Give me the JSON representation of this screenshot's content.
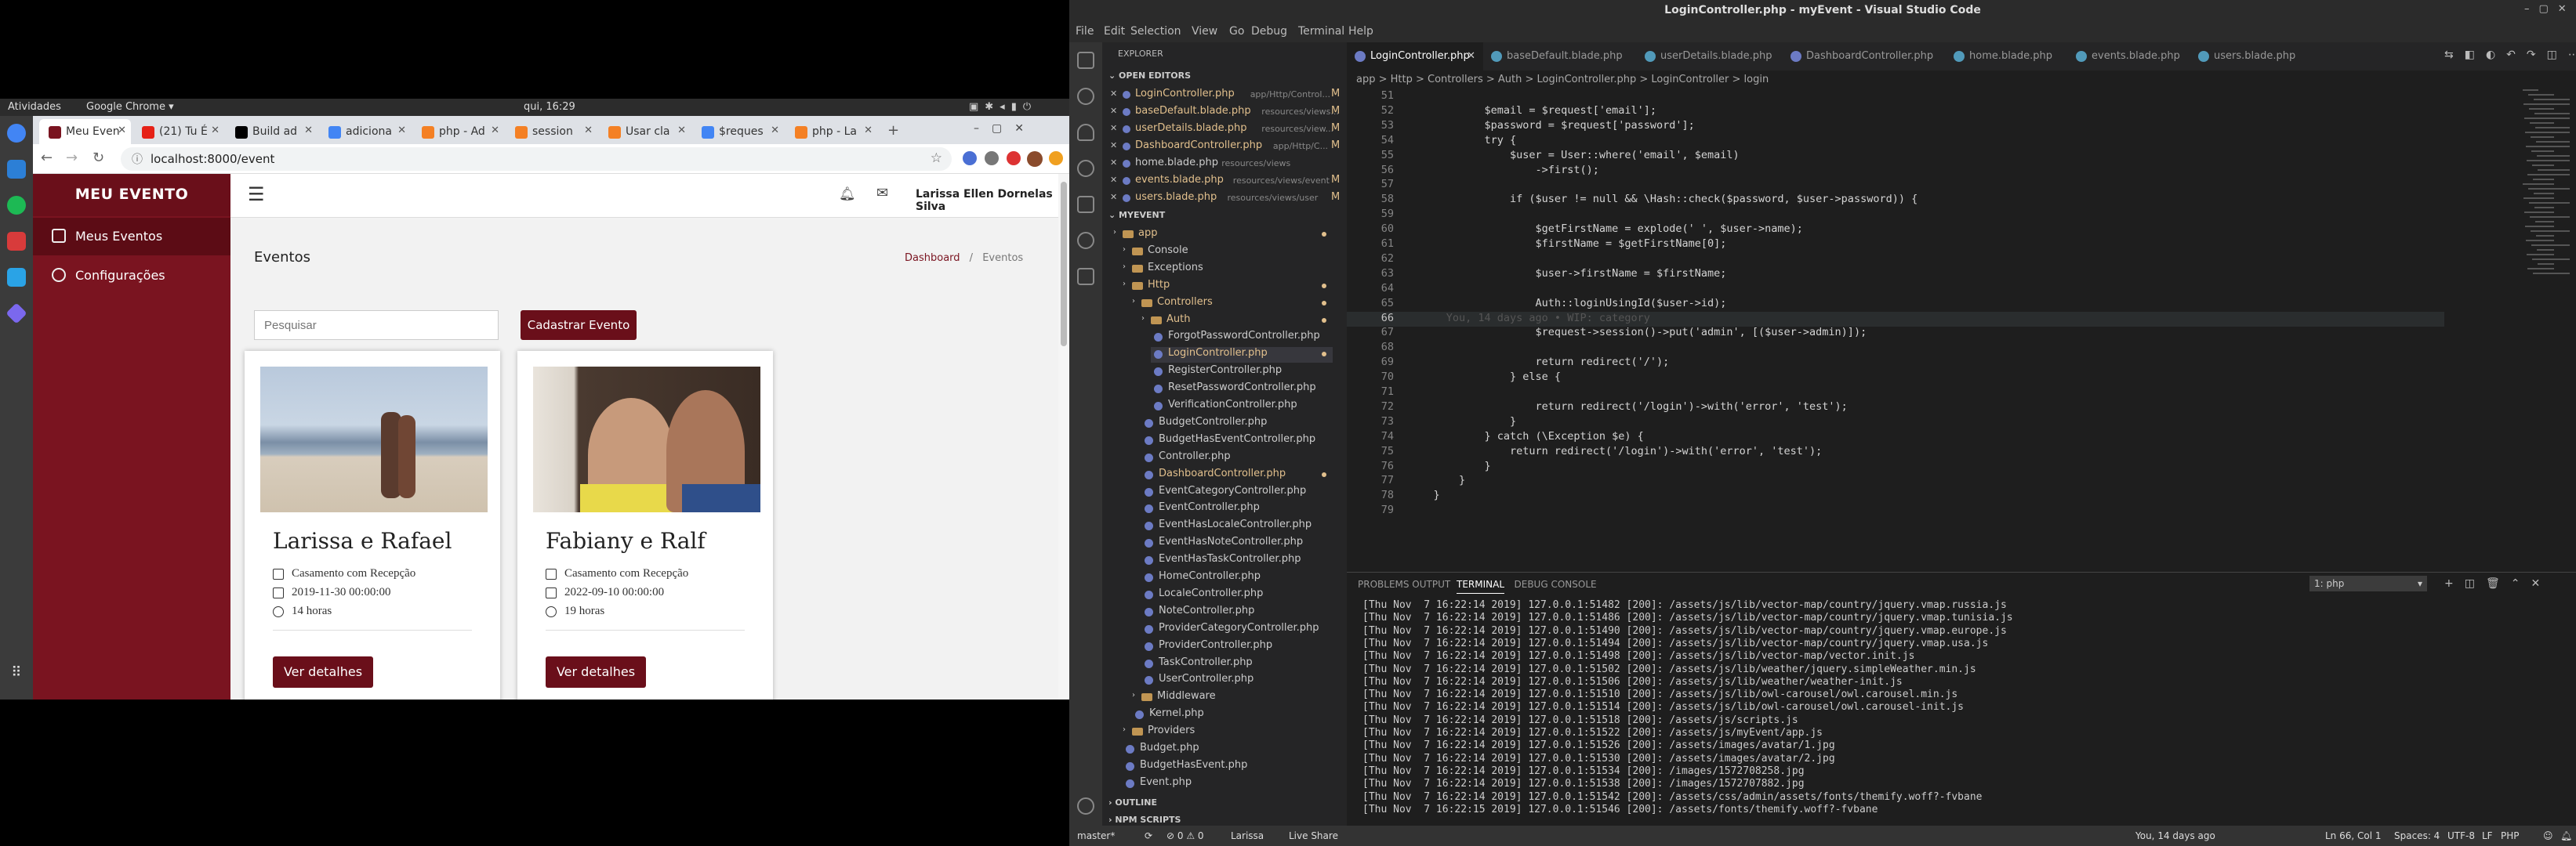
{
  "system": {
    "activities": "Atividades",
    "app_menu": "Google Chrome ▾",
    "clock": "qui, 16:29"
  },
  "chrome": {
    "tabs": [
      {
        "label": "Meu Even",
        "color": "#7a1420"
      },
      {
        "label": "(21) Tu É",
        "color": "#e62117"
      },
      {
        "label": "Build ad",
        "color": "#000000"
      },
      {
        "label": "adiciona",
        "color": "#4285f4"
      },
      {
        "label": "php - Ad",
        "color": "#f48024"
      },
      {
        "label": "session",
        "color": "#f48024"
      },
      {
        "label": "Usar cla",
        "color": "#f48024"
      },
      {
        "label": "$reques",
        "color": "#4285f4"
      },
      {
        "label": "php - La",
        "color": "#f48024"
      }
    ],
    "url": "localhost:8000/event"
  },
  "app": {
    "brand": "MEU EVENTO",
    "nav": [
      {
        "label": "Meus Eventos",
        "icon": "calendar-icon"
      },
      {
        "label": "Configurações",
        "icon": "gear-icon"
      }
    ],
    "user": "Larissa Ellen Dornelas Silva",
    "page_title": "Eventos",
    "breadcrumb": {
      "home": "Dashboard",
      "sep": "/",
      "current": "Eventos"
    },
    "search_placeholder": "Pesquisar",
    "create_button": "Cadastrar Evento",
    "events": [
      {
        "title": "Larissa e Rafael",
        "type": "Casamento  com  Recepção",
        "datetime": "2019-11-30  00:00:00",
        "duration": "14  horas",
        "button": "Ver detalhes"
      },
      {
        "title": "Fabiany e Ralf",
        "type": "Casamento  com  Recepção",
        "datetime": "2022-09-10  00:00:00",
        "duration": "19  horas",
        "button": "Ver detalhes"
      }
    ]
  },
  "vscode": {
    "title": "LoginController.php - myEvent - Visual Studio Code",
    "menu": [
      "File",
      "Edit",
      "Selection",
      "View",
      "Go",
      "Debug",
      "Terminal",
      "Help"
    ],
    "explorer_header": "EXPLORER",
    "open_editors_header": "OPEN EDITORS",
    "open_editors": [
      {
        "name": "LoginController.php",
        "path": "app/Http/Control...",
        "badge": "M",
        "color": "#e2c08d"
      },
      {
        "name": "baseDefault.blade.php",
        "path": "resources/views...",
        "badge": "M",
        "color": "#e2c08d"
      },
      {
        "name": "userDetails.blade.php",
        "path": "resources/view...",
        "badge": "M",
        "color": "#e2c08d"
      },
      {
        "name": "DashboardController.php",
        "path": "app/Http/C...",
        "badge": "M",
        "color": "#e2c08d"
      },
      {
        "name": "home.blade.php",
        "path": "resources/views",
        "badge": "",
        "color": "#cccccc"
      },
      {
        "name": "events.blade.php",
        "path": "resources/views/event",
        "badge": "M",
        "color": "#e2c08d"
      },
      {
        "name": "users.blade.php",
        "path": "resources/views/user",
        "badge": "M",
        "color": "#e2c08d"
      }
    ],
    "project_header": "MYEVENT",
    "tree": [
      {
        "name": "app",
        "indent": 0,
        "folder": true,
        "color": "#e2c08d"
      },
      {
        "name": "Console",
        "indent": 1,
        "folder": true,
        "color": "#cccccc"
      },
      {
        "name": "Exceptions",
        "indent": 1,
        "folder": true,
        "color": "#cccccc"
      },
      {
        "name": "Http",
        "indent": 1,
        "folder": true,
        "color": "#e2c08d"
      },
      {
        "name": "Controllers",
        "indent": 2,
        "folder": true,
        "color": "#e2c08d"
      },
      {
        "name": "Auth",
        "indent": 3,
        "folder": true,
        "color": "#e2c08d"
      },
      {
        "name": "ForgotPasswordController.php",
        "indent": 4,
        "folder": false,
        "color": "#cccccc"
      },
      {
        "name": "LoginController.php",
        "indent": 4,
        "folder": false,
        "color": "#e2c08d"
      },
      {
        "name": "RegisterController.php",
        "indent": 4,
        "folder": false,
        "color": "#cccccc"
      },
      {
        "name": "ResetPasswordController.php",
        "indent": 4,
        "folder": false,
        "color": "#cccccc"
      },
      {
        "name": "VerificationController.php",
        "indent": 4,
        "folder": false,
        "color": "#cccccc"
      },
      {
        "name": "BudgetController.php",
        "indent": 3,
        "folder": false,
        "color": "#cccccc"
      },
      {
        "name": "BudgetHasEventController.php",
        "indent": 3,
        "folder": false,
        "color": "#cccccc"
      },
      {
        "name": "Controller.php",
        "indent": 3,
        "folder": false,
        "color": "#cccccc"
      },
      {
        "name": "DashboardController.php",
        "indent": 3,
        "folder": false,
        "color": "#e2c08d"
      },
      {
        "name": "EventCategoryController.php",
        "indent": 3,
        "folder": false,
        "color": "#cccccc"
      },
      {
        "name": "EventController.php",
        "indent": 3,
        "folder": false,
        "color": "#cccccc"
      },
      {
        "name": "EventHasLocaleController.php",
        "indent": 3,
        "folder": false,
        "color": "#cccccc"
      },
      {
        "name": "EventHasNoteController.php",
        "indent": 3,
        "folder": false,
        "color": "#cccccc"
      },
      {
        "name": "EventHasTaskController.php",
        "indent": 3,
        "folder": false,
        "color": "#cccccc"
      },
      {
        "name": "HomeController.php",
        "indent": 3,
        "folder": false,
        "color": "#cccccc"
      },
      {
        "name": "LocaleController.php",
        "indent": 3,
        "folder": false,
        "color": "#cccccc"
      },
      {
        "name": "NoteController.php",
        "indent": 3,
        "folder": false,
        "color": "#cccccc"
      },
      {
        "name": "ProviderCategoryController.php",
        "indent": 3,
        "folder": false,
        "color": "#cccccc"
      },
      {
        "name": "ProviderController.php",
        "indent": 3,
        "folder": false,
        "color": "#cccccc"
      },
      {
        "name": "TaskController.php",
        "indent": 3,
        "folder": false,
        "color": "#cccccc"
      },
      {
        "name": "UserController.php",
        "indent": 3,
        "folder": false,
        "color": "#cccccc"
      },
      {
        "name": "Middleware",
        "indent": 2,
        "folder": true,
        "color": "#cccccc"
      },
      {
        "name": "Kernel.php",
        "indent": 2,
        "folder": false,
        "color": "#cccccc"
      },
      {
        "name": "Providers",
        "indent": 1,
        "folder": true,
        "color": "#cccccc"
      },
      {
        "name": "Budget.php",
        "indent": 1,
        "folder": false,
        "color": "#cccccc"
      },
      {
        "name": "BudgetHasEvent.php",
        "indent": 1,
        "folder": false,
        "color": "#cccccc"
      },
      {
        "name": "Event.php",
        "indent": 1,
        "folder": false,
        "color": "#cccccc"
      }
    ],
    "outline": "OUTLINE",
    "npm": "NPM SCRIPTS",
    "tabs": [
      "LoginController.php",
      "baseDefault.blade.php",
      "userDetails.blade.php",
      "DashboardController.php",
      "home.blade.php",
      "events.blade.php",
      "users.blade.php"
    ],
    "breadcrumb": "app  >  Http  >  Controllers  >  Auth  >  LoginController.php  >  LoginController  >  login",
    "code": [
      {
        "n": "51",
        "t": ""
      },
      {
        "n": "52",
        "t": "            $email = $request['email'];"
      },
      {
        "n": "53",
        "t": "            $password = $request['password'];"
      },
      {
        "n": "54",
        "t": "            try {"
      },
      {
        "n": "55",
        "t": "                $user = User::where('email', $email)"
      },
      {
        "n": "56",
        "t": "                    ->first();"
      },
      {
        "n": "57",
        "t": ""
      },
      {
        "n": "58",
        "t": "                if ($user != null && \\Hash::check($password, $user->password)) {"
      },
      {
        "n": "59",
        "t": ""
      },
      {
        "n": "60",
        "t": "                    $getFirstName = explode(' ', $user->name);"
      },
      {
        "n": "61",
        "t": "                    $firstName = $getFirstName[0];"
      },
      {
        "n": "62",
        "t": ""
      },
      {
        "n": "63",
        "t": "                    $user->firstName = $firstName;"
      },
      {
        "n": "64",
        "t": ""
      },
      {
        "n": "65",
        "t": "                    Auth::loginUsingId($user->id);"
      },
      {
        "n": "66",
        "t": "      You, 14 days ago • WIP: category"
      },
      {
        "n": "67",
        "t": "                    $request->session()->put('admin', [($user->admin)]);"
      },
      {
        "n": "68",
        "t": ""
      },
      {
        "n": "69",
        "t": "                    return redirect('/');"
      },
      {
        "n": "70",
        "t": "                } else {"
      },
      {
        "n": "71",
        "t": ""
      },
      {
        "n": "72",
        "t": "                    return redirect('/login')->with('error', 'test');"
      },
      {
        "n": "73",
        "t": "                }"
      },
      {
        "n": "74",
        "t": "            } catch (\\Exception $e) {"
      },
      {
        "n": "75",
        "t": "                return redirect('/login')->with('error', 'test');"
      },
      {
        "n": "76",
        "t": "            }"
      },
      {
        "n": "77",
        "t": "        }"
      },
      {
        "n": "78",
        "t": "    }"
      },
      {
        "n": "79",
        "t": ""
      }
    ],
    "panel_tabs": [
      "PROBLEMS",
      "OUTPUT",
      "TERMINAL",
      "DEBUG CONSOLE"
    ],
    "terminal_select": "1: php",
    "terminal": [
      "[Thu Nov  7 16:22:14 2019] 127.0.0.1:51482 [200]: /assets/js/lib/vector-map/country/jquery.vmap.russia.js",
      "[Thu Nov  7 16:22:14 2019] 127.0.0.1:51486 [200]: /assets/js/lib/vector-map/country/jquery.vmap.tunisia.js",
      "[Thu Nov  7 16:22:14 2019] 127.0.0.1:51490 [200]: /assets/js/lib/vector-map/country/jquery.vmap.europe.js",
      "[Thu Nov  7 16:22:14 2019] 127.0.0.1:51494 [200]: /assets/js/lib/vector-map/country/jquery.vmap.usa.js",
      "[Thu Nov  7 16:22:14 2019] 127.0.0.1:51498 [200]: /assets/js/lib/vector-map/vector.init.js",
      "[Thu Nov  7 16:22:14 2019] 127.0.0.1:51502 [200]: /assets/js/lib/weather/jquery.simpleWeather.min.js",
      "[Thu Nov  7 16:22:14 2019] 127.0.0.1:51506 [200]: /assets/js/lib/weather/weather-init.js",
      "[Thu Nov  7 16:22:14 2019] 127.0.0.1:51510 [200]: /assets/js/lib/owl-carousel/owl.carousel.min.js",
      "[Thu Nov  7 16:22:14 2019] 127.0.0.1:51514 [200]: /assets/js/lib/owl-carousel/owl.carousel-init.js",
      "[Thu Nov  7 16:22:14 2019] 127.0.0.1:51518 [200]: /assets/js/scripts.js",
      "[Thu Nov  7 16:22:14 2019] 127.0.0.1:51522 [200]: /assets/js/myEvent/app.js",
      "[Thu Nov  7 16:22:14 2019] 127.0.0.1:51526 [200]: /assets/images/avatar/1.jpg",
      "[Thu Nov  7 16:22:14 2019] 127.0.0.1:51530 [200]: /assets/images/avatar/2.jpg",
      "[Thu Nov  7 16:22:14 2019] 127.0.0.1:51534 [200]: /images/1572708258.jpg",
      "[Thu Nov  7 16:22:14 2019] 127.0.0.1:51538 [200]: /images/1572707882.jpg",
      "[Thu Nov  7 16:22:14 2019] 127.0.0.1:51542 [200]: /assets/css/admin/assets/fonts/themify.woff?-fvbane",
      "[Thu Nov  7 16:22:15 2019] 127.0.0.1:51546 [200]: /assets/fonts/themify.woff?-fvbane"
    ],
    "status": {
      "branch": "master*",
      "problems": "⊘ 0 ⚠ 0",
      "user": "Larissa",
      "liveshare": "Live Share",
      "blame": "You, 14 days ago",
      "position": "Ln 66, Col 1",
      "spaces": "Spaces: 4",
      "encoding": "UTF-8",
      "eol": "LF",
      "lang": "PHP"
    }
  }
}
